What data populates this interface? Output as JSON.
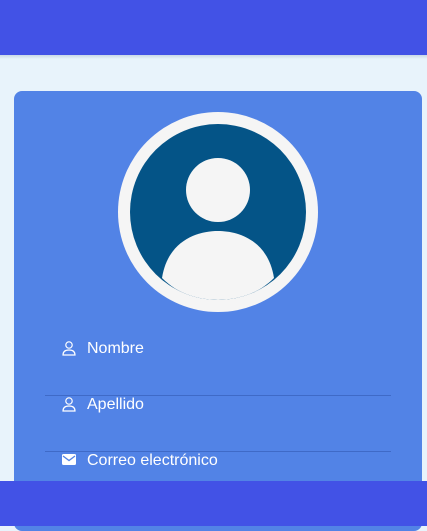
{
  "profile": {
    "avatar_icon": "user-avatar-icon",
    "fields": [
      {
        "label": "Nombre",
        "icon": "person-outline-icon"
      },
      {
        "label": "Apellido",
        "icon": "person-outline-icon"
      },
      {
        "label": "Correo electrónico",
        "icon": "mail-icon"
      }
    ]
  },
  "colors": {
    "header": "#4252e6",
    "background": "#e8f3fb",
    "card": "#5283e6",
    "avatar_circle": "#045487",
    "avatar_ring": "#f5f5f5",
    "text": "#ffffff"
  }
}
